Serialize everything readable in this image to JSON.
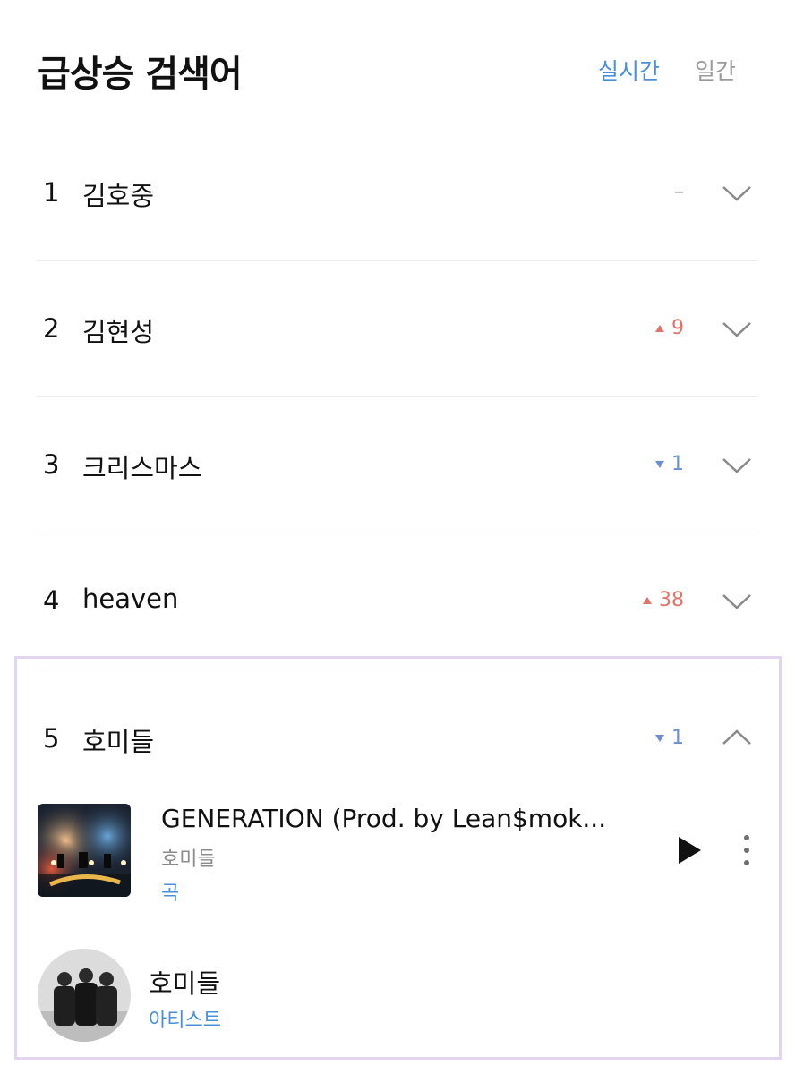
{
  "header": {
    "title": "급상승 검색어",
    "tabs": [
      {
        "label": "실시간",
        "active": true
      },
      {
        "label": "일간",
        "active": false
      }
    ]
  },
  "rankings": [
    {
      "rank": "1",
      "keyword": "김호중",
      "change": "–",
      "direction": "same",
      "expanded": false
    },
    {
      "rank": "2",
      "keyword": "김현성",
      "change": "9",
      "direction": "up",
      "expanded": false
    },
    {
      "rank": "3",
      "keyword": "크리스마스",
      "change": "1",
      "direction": "down",
      "expanded": false
    },
    {
      "rank": "4",
      "keyword": "heaven",
      "change": "38",
      "direction": "up",
      "expanded": false
    },
    {
      "rank": "5",
      "keyword": "호미들",
      "change": "1",
      "direction": "down",
      "expanded": true
    }
  ],
  "expanded": {
    "song": {
      "title": "GENERATION (Prod. by Lean$mok...",
      "artist": "호미들",
      "type": "곡"
    },
    "artist": {
      "name": "호미들",
      "type": "아티스트"
    }
  },
  "colors": {
    "accent": "#4a90d9",
    "up": "#e0736a",
    "down": "#6b8fd6",
    "highlight_border": "#e3d4f2"
  }
}
